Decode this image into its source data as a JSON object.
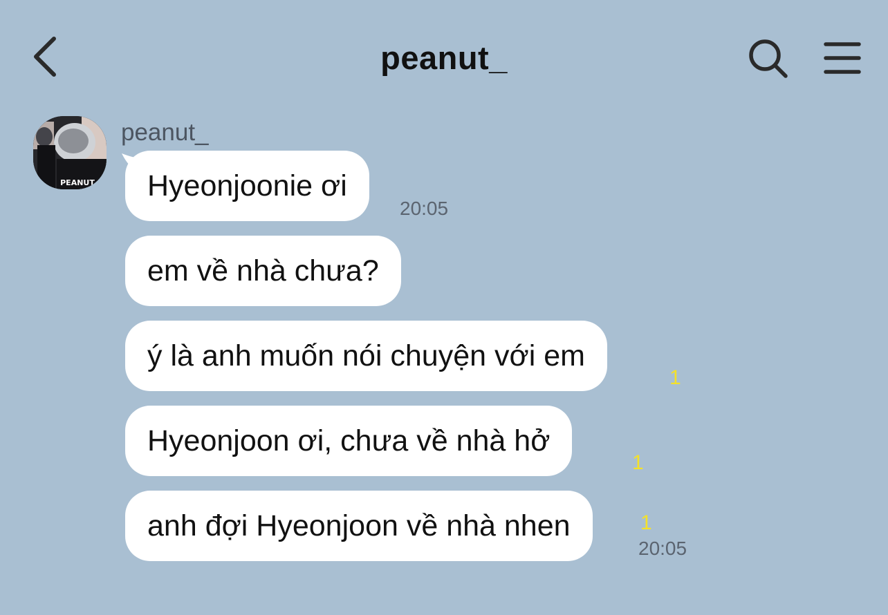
{
  "header": {
    "title": "peanut_",
    "back_icon": "chevron-left-icon",
    "search_icon": "search-icon",
    "menu_icon": "hamburger-menu-icon"
  },
  "conversation": {
    "sender_name": "peanut_",
    "avatar_label": "PEANUT",
    "messages": [
      {
        "text": "Hyeonjoonie ơi",
        "time": "20:05",
        "unread": ""
      },
      {
        "text": "em về nhà chưa?",
        "time": "",
        "unread": ""
      },
      {
        "text": "ý là anh muốn nói chuyện với em",
        "time": "",
        "unread": "1"
      },
      {
        "text": "Hyeonjoon ơi, chưa về nhà hở",
        "time": "",
        "unread": "1"
      },
      {
        "text": "anh đợi Hyeonjoon về nhà nhen",
        "time": "20:05",
        "unread": "1"
      }
    ]
  },
  "colors": {
    "background": "#a9bfd2",
    "bubble": "#ffffff",
    "unread_badge": "#f4e12a",
    "timestamp": "#5b6470"
  }
}
